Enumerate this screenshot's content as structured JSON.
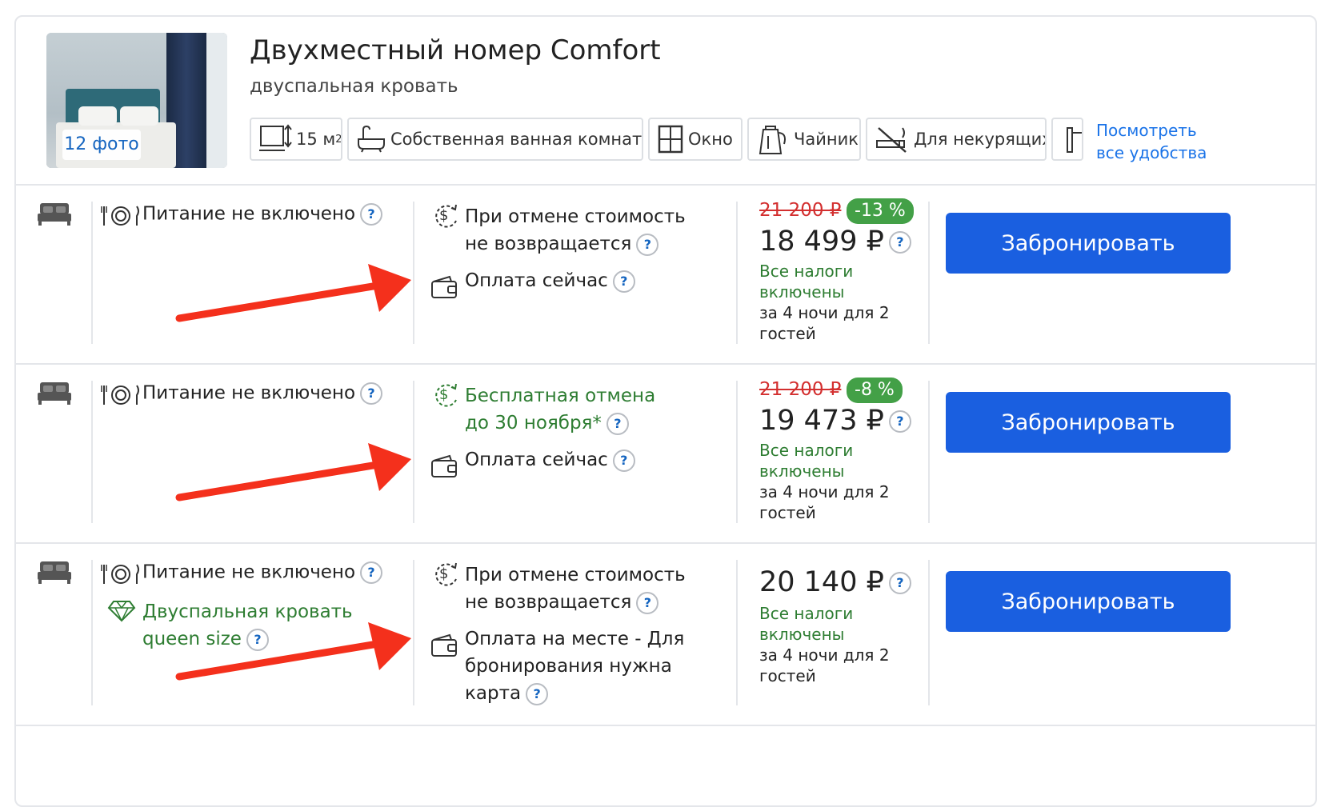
{
  "room": {
    "title": "Двухместный номер Comfort",
    "subtitle": "двуспальная кровать",
    "photo_badge": "12 фото",
    "amenities": [
      "15 м",
      "Собственная ванная комната",
      "Окно",
      "Чайник",
      "Для некурящих"
    ],
    "area_sup": "2",
    "see_all_line1": "Посмотреть",
    "see_all_line2": "все удобства"
  },
  "common": {
    "qmark": "?",
    "book_label": "Забронировать",
    "taxes_line1": "Все налоги",
    "taxes_line2": "включены",
    "nights_line1": "за 4 ночи для 2",
    "nights_line2": "гостей",
    "meal": "Питание не включено"
  },
  "offers": [
    {
      "cancel_line1": "При отмене стоимость",
      "cancel_line2": "не возвращается",
      "cancel_free": false,
      "payment_lines": [
        "Оплата сейчас"
      ],
      "old_price": "21 200 ₽",
      "discount": "-13 %",
      "price": "18 499 ₽"
    },
    {
      "cancel_line1": "Бесплатная отмена",
      "cancel_line2": "до 30 ноября*",
      "cancel_free": true,
      "payment_lines": [
        "Оплата сейчас"
      ],
      "old_price": "21 200 ₽",
      "discount": "-8 %",
      "price": "19 473 ₽"
    },
    {
      "cancel_line1": "При отмене стоимость",
      "cancel_line2": "не возвращается",
      "cancel_free": false,
      "extra_line1": "Двуспальная кровать",
      "extra_line2": "queen size",
      "payment_lines": [
        "Оплата на месте - Для",
        "бронирования нужна",
        "карта"
      ],
      "price": "20 140 ₽"
    }
  ],
  "colors": {
    "accent_blue": "#1a5fe0",
    "link_blue": "#1a73e8",
    "green": "#2e7d32",
    "badge_green": "#43a047",
    "old_price_red": "#d32f2f",
    "arrow_red": "#f4301c"
  }
}
